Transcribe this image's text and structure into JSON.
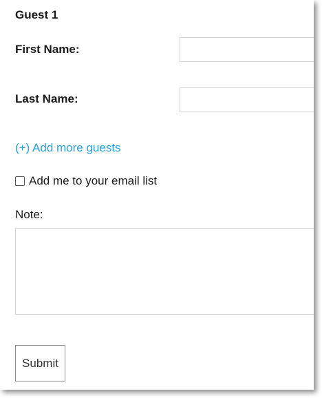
{
  "form": {
    "guest_heading": "Guest 1",
    "first_name": {
      "label": "First Name:",
      "value": "",
      "placeholder": ""
    },
    "last_name": {
      "label": "Last Name:",
      "value": "",
      "placeholder": ""
    },
    "add_more_guests": "(+) Add more guests",
    "email_list": {
      "label": "Add me to your email list",
      "checked": false
    },
    "note": {
      "label": "Note:",
      "value": ""
    },
    "submit_label": "Submit"
  },
  "colors": {
    "link": "#2a9fd8",
    "input_border": "#d2d2d2",
    "button_border": "#8c8c8c",
    "text": "#1a1a1a"
  }
}
